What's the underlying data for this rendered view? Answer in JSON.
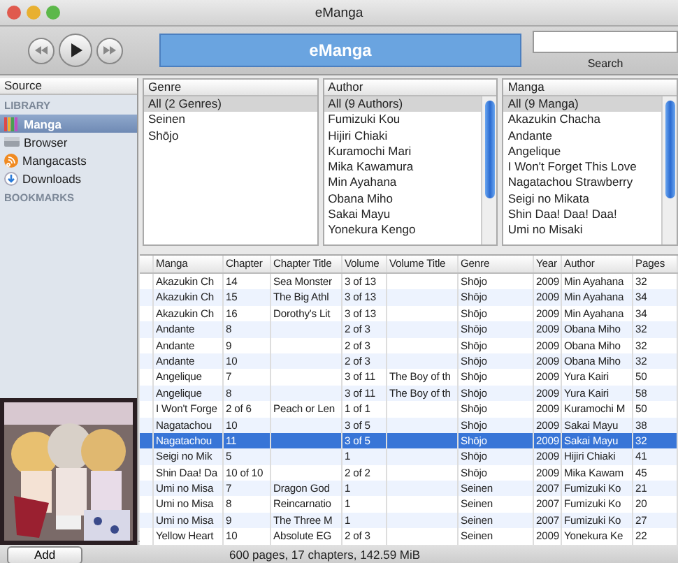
{
  "window": {
    "title": "eManga"
  },
  "toolbar": {
    "display": "eManga",
    "search_label": "Search"
  },
  "sidebar": {
    "header": "Source",
    "sections": [
      {
        "title": "LIBRARY",
        "items": [
          {
            "kind": "manga",
            "label": "Manga",
            "selected": true
          },
          {
            "kind": "browser",
            "label": "Browser",
            "selected": false
          },
          {
            "kind": "cast",
            "label": "Mangacasts",
            "selected": false
          },
          {
            "kind": "download",
            "label": "Downloads",
            "selected": false
          }
        ]
      },
      {
        "title": "BOOKMARKS"
      }
    ]
  },
  "panes": [
    {
      "header": "Genre",
      "scrollbar": false,
      "items": [
        {
          "label": "All (2 Genres)",
          "selected": true
        },
        {
          "label": "Seinen",
          "selected": false
        },
        {
          "label": "Shōjo",
          "selected": false
        }
      ]
    },
    {
      "header": "Author",
      "scrollbar": true,
      "items": [
        {
          "label": "All (9 Authors)",
          "selected": true
        },
        {
          "label": "Fumizuki Kou",
          "selected": false
        },
        {
          "label": "Hijiri Chiaki",
          "selected": false
        },
        {
          "label": "Kuramochi Mari",
          "selected": false
        },
        {
          "label": "Mika Kawamura",
          "selected": false
        },
        {
          "label": "Min Ayahana",
          "selected": false
        },
        {
          "label": "Obana Miho",
          "selected": false
        },
        {
          "label": "Sakai Mayu",
          "selected": false
        },
        {
          "label": "Yonekura Kengo",
          "selected": false
        }
      ]
    },
    {
      "header": "Manga",
      "scrollbar": true,
      "items": [
        {
          "label": "All (9 Manga)",
          "selected": true
        },
        {
          "label": "Akazukin Chacha",
          "selected": false
        },
        {
          "label": "Andante",
          "selected": false
        },
        {
          "label": "Angelique",
          "selected": false
        },
        {
          "label": "I Won't Forget This Love",
          "selected": false
        },
        {
          "label": "Nagatachou Strawberry",
          "selected": false
        },
        {
          "label": "Seigi no Mikata",
          "selected": false
        },
        {
          "label": "Shin Daa! Daa! Daa!",
          "selected": false
        },
        {
          "label": "Umi no Misaki",
          "selected": false
        }
      ]
    }
  ],
  "table": {
    "columns": [
      "Manga",
      "Chapter",
      "Chapter Title",
      "Volume",
      "Volume Title",
      "Genre",
      "Year",
      "Author",
      "Pages"
    ],
    "rows": [
      {
        "selected": false,
        "cells": [
          "Akazukin Ch",
          "14",
          "Sea Monster",
          "3 of 13",
          "",
          "Shōjo",
          "2009",
          "Min Ayahana",
          "32"
        ]
      },
      {
        "selected": false,
        "cells": [
          "Akazukin Ch",
          "15",
          "The Big Athl",
          "3 of 13",
          "",
          "Shōjo",
          "2009",
          "Min Ayahana",
          "34"
        ]
      },
      {
        "selected": false,
        "cells": [
          "Akazukin Ch",
          "16",
          "Dorothy's Lit",
          "3 of 13",
          "",
          "Shōjo",
          "2009",
          "Min Ayahana",
          "34"
        ]
      },
      {
        "selected": false,
        "cells": [
          "Andante",
          "8",
          "",
          "2 of 3",
          "",
          "Shōjo",
          "2009",
          "Obana Miho",
          "32"
        ]
      },
      {
        "selected": false,
        "cells": [
          "Andante",
          "9",
          "",
          "2 of 3",
          "",
          "Shōjo",
          "2009",
          "Obana Miho",
          "32"
        ]
      },
      {
        "selected": false,
        "cells": [
          "Andante",
          "10",
          "",
          "2 of 3",
          "",
          "Shōjo",
          "2009",
          "Obana Miho",
          "32"
        ]
      },
      {
        "selected": false,
        "cells": [
          "Angelique",
          "7",
          "",
          "3 of 11",
          "The Boy of th",
          "Shōjo",
          "2009",
          "Yura Kairi",
          "50"
        ]
      },
      {
        "selected": false,
        "cells": [
          "Angelique",
          "8",
          "",
          "3 of 11",
          "The Boy of th",
          "Shōjo",
          "2009",
          "Yura Kairi",
          "58"
        ]
      },
      {
        "selected": false,
        "cells": [
          "I Won't Forge",
          "2 of 6",
          "Peach or Len",
          "1 of 1",
          "",
          "Shōjo",
          "2009",
          "Kuramochi M",
          "50"
        ]
      },
      {
        "selected": false,
        "cells": [
          "Nagatachou",
          "10",
          "",
          "3 of 5",
          "",
          "Shōjo",
          "2009",
          "Sakai Mayu",
          "38"
        ]
      },
      {
        "selected": true,
        "cells": [
          "Nagatachou",
          "11",
          "",
          "3 of 5",
          "",
          "Shōjo",
          "2009",
          "Sakai Mayu",
          "32"
        ]
      },
      {
        "selected": false,
        "cells": [
          "Seigi no Mik",
          "5",
          "",
          "1",
          "",
          "Shōjo",
          "2009",
          "Hijiri Chiaki",
          "41"
        ]
      },
      {
        "selected": false,
        "cells": [
          "Shin Daa! Da",
          "10 of 10",
          "",
          "2 of 2",
          "",
          "Shōjo",
          "2009",
          "Mika Kawam",
          "45"
        ]
      },
      {
        "selected": false,
        "cells": [
          "Umi no Misa",
          "7",
          "Dragon God",
          "1",
          "",
          "Seinen",
          "2007",
          "Fumizuki Ko",
          "21"
        ]
      },
      {
        "selected": false,
        "cells": [
          "Umi no Misa",
          "8",
          "Reincarnatio",
          "1",
          "",
          "Seinen",
          "2007",
          "Fumizuki Ko",
          "20"
        ]
      },
      {
        "selected": false,
        "cells": [
          "Umi no Misa",
          "9",
          "The Three M",
          "1",
          "",
          "Seinen",
          "2007",
          "Fumizuki Ko",
          "27"
        ]
      },
      {
        "selected": false,
        "cells": [
          "Yellow Heart",
          "10",
          "Absolute EG",
          "2 of 3",
          "",
          "Seinen",
          "2009",
          "Yonekura Ke",
          "22"
        ]
      }
    ]
  },
  "status_bar": {
    "add_button": "Add",
    "summary": "600 pages, 17 chapters, 142.59 MiB"
  }
}
